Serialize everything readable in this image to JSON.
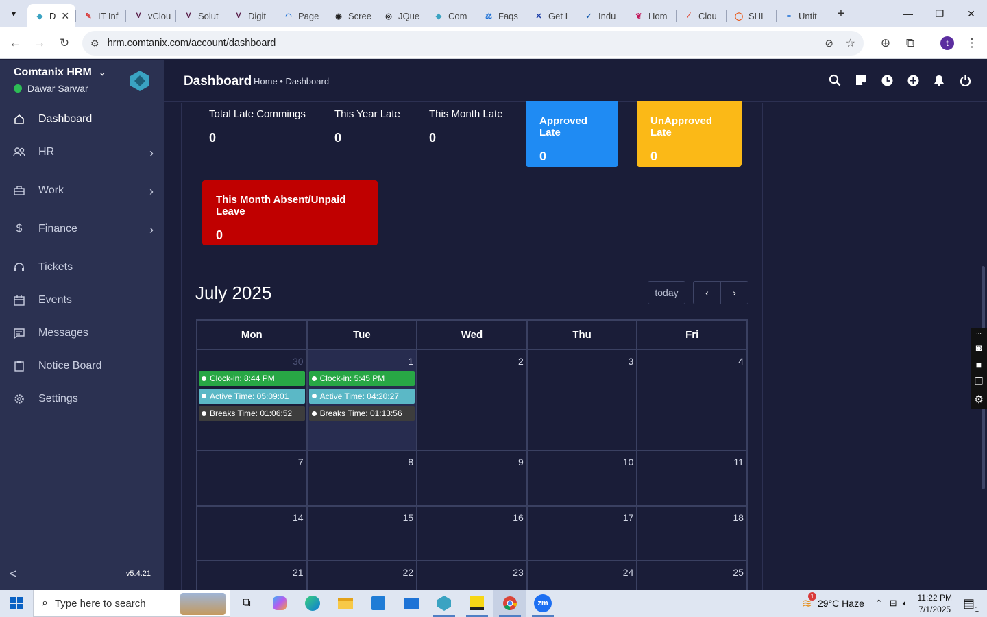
{
  "browser": {
    "tabs": [
      {
        "label": "D",
        "color": "#3aa3c2",
        "glyph": "◆"
      },
      {
        "label": "IT Inf",
        "color": "#d93a3a",
        "glyph": "✎"
      },
      {
        "label": "vClou",
        "color": "#5a1e4a",
        "glyph": "V"
      },
      {
        "label": "Solut",
        "color": "#5a1e4a",
        "glyph": "V"
      },
      {
        "label": "Digit",
        "color": "#5a1e4a",
        "glyph": "V"
      },
      {
        "label": "Page",
        "color": "#1a6fd6",
        "glyph": "◠"
      },
      {
        "label": "Scree",
        "color": "#222222",
        "glyph": "◉"
      },
      {
        "label": "JQue",
        "color": "#222222",
        "glyph": "◎"
      },
      {
        "label": "Com",
        "color": "#3aa3c2",
        "glyph": "◆"
      },
      {
        "label": "Faqs",
        "color": "#1a6fd6",
        "glyph": "⚖"
      },
      {
        "label": "Get I",
        "color": "#1b3da8",
        "glyph": "✕"
      },
      {
        "label": "Indu",
        "color": "#1a5fb0",
        "glyph": "✓"
      },
      {
        "label": "Hom",
        "color": "#c2185b",
        "glyph": "❦"
      },
      {
        "label": "Clou",
        "color": "#e0402a",
        "glyph": "∕"
      },
      {
        "label": "SHI",
        "color": "#e85a1c",
        "glyph": "◯"
      },
      {
        "label": "Untit",
        "color": "#1a6fd6",
        "glyph": "≡"
      }
    ],
    "url": "hrm.comtanix.com/account/dashboard",
    "profile_initial": "t"
  },
  "sidebar": {
    "brand": "Comtanix HRM",
    "user": "Dawar Sarwar",
    "items": [
      {
        "label": "Dashboard",
        "icon": "home-icon"
      },
      {
        "label": "HR",
        "icon": "users-icon"
      },
      {
        "label": "Work",
        "icon": "briefcase-icon"
      },
      {
        "label": "Finance",
        "icon": "dollar-icon"
      },
      {
        "label": "Tickets",
        "icon": "headset-icon"
      },
      {
        "label": "Events",
        "icon": "calendar-icon"
      },
      {
        "label": "Messages",
        "icon": "message-icon"
      },
      {
        "label": "Notice Board",
        "icon": "clipboard-icon"
      },
      {
        "label": "Settings",
        "icon": "gear-icon"
      }
    ],
    "version": "v5.4.21"
  },
  "header": {
    "title": "Dashboard",
    "breadcrumb": "Home • Dashboard"
  },
  "stats": {
    "total_late": {
      "label": "Total Late Commings",
      "value": "0"
    },
    "year_late": {
      "label": "This Year Late",
      "value": "0"
    },
    "month_late": {
      "label": "This Month Late",
      "value": "0"
    },
    "approved": {
      "label": "Approved Late",
      "value": "0",
      "color": "#1f8bf3"
    },
    "unapproved": {
      "label": "UnApproved Late",
      "value": "0",
      "color": "#fbb917"
    },
    "absent": {
      "label": "This Month Absent/Unpaid Leave",
      "value": "0",
      "color": "#c00000"
    }
  },
  "calendar": {
    "title": "July 2025",
    "today_label": "today",
    "days": [
      "Mon",
      "Tue",
      "Wed",
      "Thu",
      "Fri"
    ],
    "rows": [
      [
        "30",
        "1",
        "2",
        "3",
        "4"
      ],
      [
        "7",
        "8",
        "9",
        "10",
        "11"
      ],
      [
        "14",
        "15",
        "16",
        "17",
        "18"
      ],
      [
        "21",
        "22",
        "23",
        "24",
        "25"
      ]
    ],
    "events": {
      "mon": [
        "Clock-in: 8:44 PM",
        "Active Time: 05:09:01",
        "Breaks Time: 01:06:52"
      ],
      "tue": [
        "Clock-in: 5:45 PM",
        "Active Time: 04:20:27",
        "Breaks Time: 01:13:56"
      ]
    },
    "event_colors": {
      "clockin": "#28a745",
      "active": "#5bb8c6",
      "breaks": "#3d3d3d"
    }
  },
  "taskbar": {
    "search_placeholder": "Type here to search",
    "weather": "29°C  Haze",
    "time": "11:22 PM",
    "date": "7/1/2025",
    "notif_count": "1",
    "weather_badge": "1"
  }
}
